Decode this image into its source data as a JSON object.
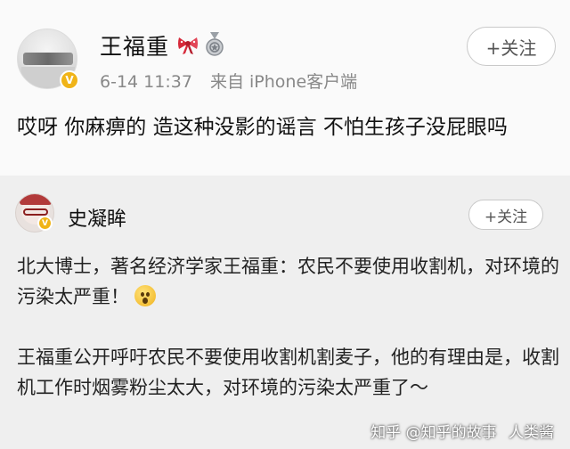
{
  "post": {
    "username": "王福重",
    "timestamp": "6-14 11:37",
    "source": "来自 iPhone客户端",
    "follow_label": "+关注",
    "text": "哎呀 你麻痹的 造这种没影的谣言  不怕生孩子没屁眼吗",
    "icons": [
      "verified-badge-icon",
      "bow-ribbon-icon",
      "medal-icon"
    ]
  },
  "repost": {
    "username": "史凝眸",
    "follow_label": "+关注",
    "paragraph1": "北大博士，著名经济学家王福重：农民不要使用收割机，对环境的污染太严重！",
    "paragraph2": "王福重公开呼吁农民不要使用收割机割麦子，他的有理由是，收割机工作时烟雾粉尘太大，对环境的污染太严重了～",
    "icons": [
      "verified-badge-icon",
      "shocked-emoji-icon"
    ]
  },
  "watermark": {
    "left": "知乎 @知乎的故事",
    "right": "人类酱"
  }
}
